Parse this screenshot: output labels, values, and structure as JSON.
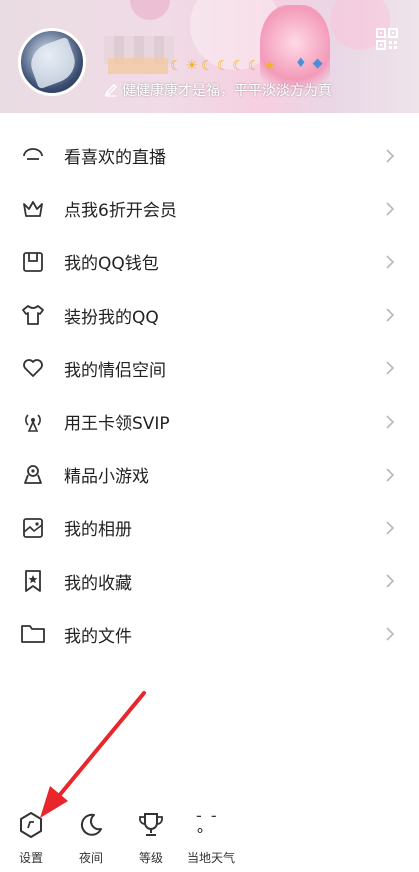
{
  "profile": {
    "signature": "健健康康才是福，平平淡淡方为真",
    "badge_icons": [
      "moon-badge",
      "sun-badge",
      "moon-badge",
      "moon-badge",
      "moon-badge",
      "moon-badge",
      "star-badge"
    ]
  },
  "menu": {
    "items": [
      {
        "label": "看喜欢的直播",
        "icon": "live-icon"
      },
      {
        "label": "点我6折开会员",
        "icon": "crown-icon"
      },
      {
        "label": "我的QQ钱包",
        "icon": "wallet-icon"
      },
      {
        "label": "装扮我的QQ",
        "icon": "tshirt-icon"
      },
      {
        "label": "我的情侣空间",
        "icon": "heart-icon"
      },
      {
        "label": "用王卡领SVIP",
        "icon": "signal-tower-icon"
      },
      {
        "label": "精品小游戏",
        "icon": "game-icon"
      },
      {
        "label": "我的相册",
        "icon": "photo-album-icon"
      },
      {
        "label": "我的收藏",
        "icon": "favorite-star-icon"
      },
      {
        "label": "我的文件",
        "icon": "folder-icon"
      }
    ]
  },
  "bottom_bar": {
    "settings": "设置",
    "night": "夜间",
    "level": "等级",
    "weather": "当地天气",
    "weather_temp": "- -°"
  },
  "colors": {
    "arrow": "#e8262b",
    "chevron": "#b8b8b8",
    "icon_stroke": "#333333"
  }
}
